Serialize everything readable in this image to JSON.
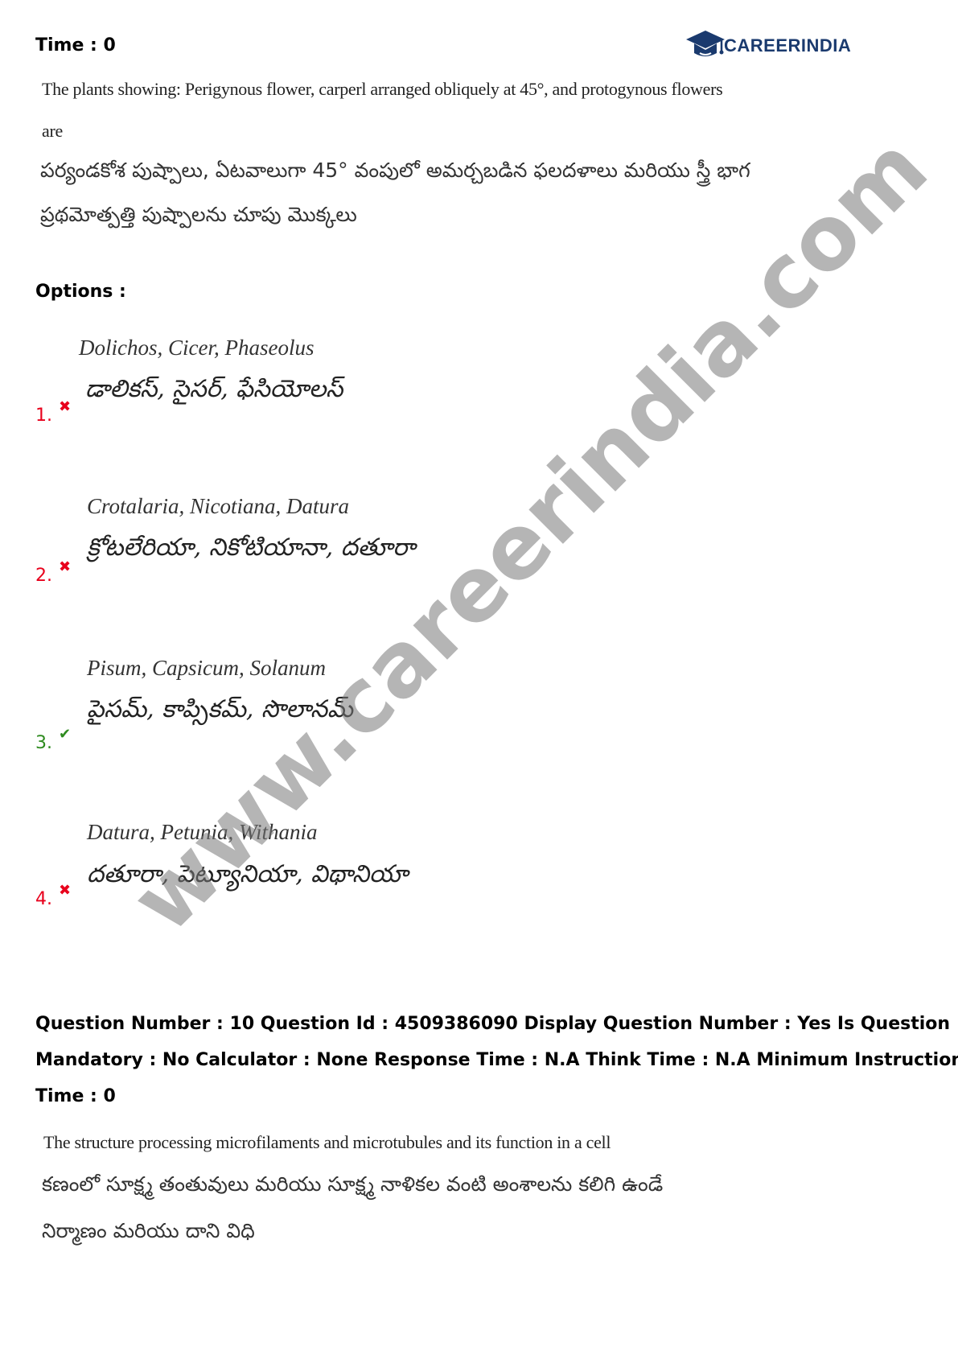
{
  "logo": {
    "text": "CAREERINDIA",
    "icon": "graduation-cap-icon",
    "color": "#1a3a6e"
  },
  "top_meta": "Time : 0",
  "question": {
    "english_lines": [
      "The plants showing: Perigynous flower, carperl arranged obliquely at 45°, and protogynous flowers",
      "are"
    ],
    "telugu_lines": [
      "పర్యండకోశ పుష్పాలు, ఏటవాలుగా 45° వంపులో అమర్చబడిన ఫలదళాలు మరియు స్త్రీ భాగ",
      "ప్రథమోత్పత్తి పుష్పాలను చూపు మొక్కలు"
    ]
  },
  "options_heading": "Options :",
  "options": [
    {
      "number": "1.",
      "english": "Dolichos, Cicer, Phaseolus",
      "telugu": "డాలికస్, సైసర్, ఫేసియోలస్",
      "status": "wrong",
      "mark_icon": "cross-icon"
    },
    {
      "number": "2.",
      "english": "Crotalaria, Nicotiana, Datura",
      "telugu": "క్రోటలేరియా, నికోటియానా, దతూరా",
      "status": "wrong",
      "mark_icon": "cross-icon"
    },
    {
      "number": "3.",
      "english": "Pisum, Capsicum, Solanum",
      "telugu": "పైసమ్, కాప్సికమ్, సొలానమ్",
      "status": "correct",
      "mark_icon": "check-icon"
    },
    {
      "number": "4.",
      "english": "Datura, Petunia, Withania",
      "telugu": "దతూరా, పెట్యూనియా, విథానియా",
      "status": "wrong",
      "mark_icon": "cross-icon"
    }
  ],
  "marks": {
    "wrong": "✖",
    "correct": "✔"
  },
  "next_meta_lines": [
    "Question Number : 10 Question Id : 4509386090 Display Question Number : Yes Is Question",
    "Mandatory : No Calculator : None Response Time : N.A Think Time : N.A Minimum Instruction",
    "Time : 0"
  ],
  "next_question": {
    "english_lines": [
      "The structure processing microfilaments and microtubules and its function in a cell"
    ],
    "telugu_lines": [
      "కణంలో సూక్ష్మ తంతువులు మరియు సూక్ష్మ నాళికల వంటి అంశాలను కలిగి ఉండే",
      "నిర్మాణం మరియు దాని విధి"
    ]
  },
  "watermark": "www.careerindia.com"
}
